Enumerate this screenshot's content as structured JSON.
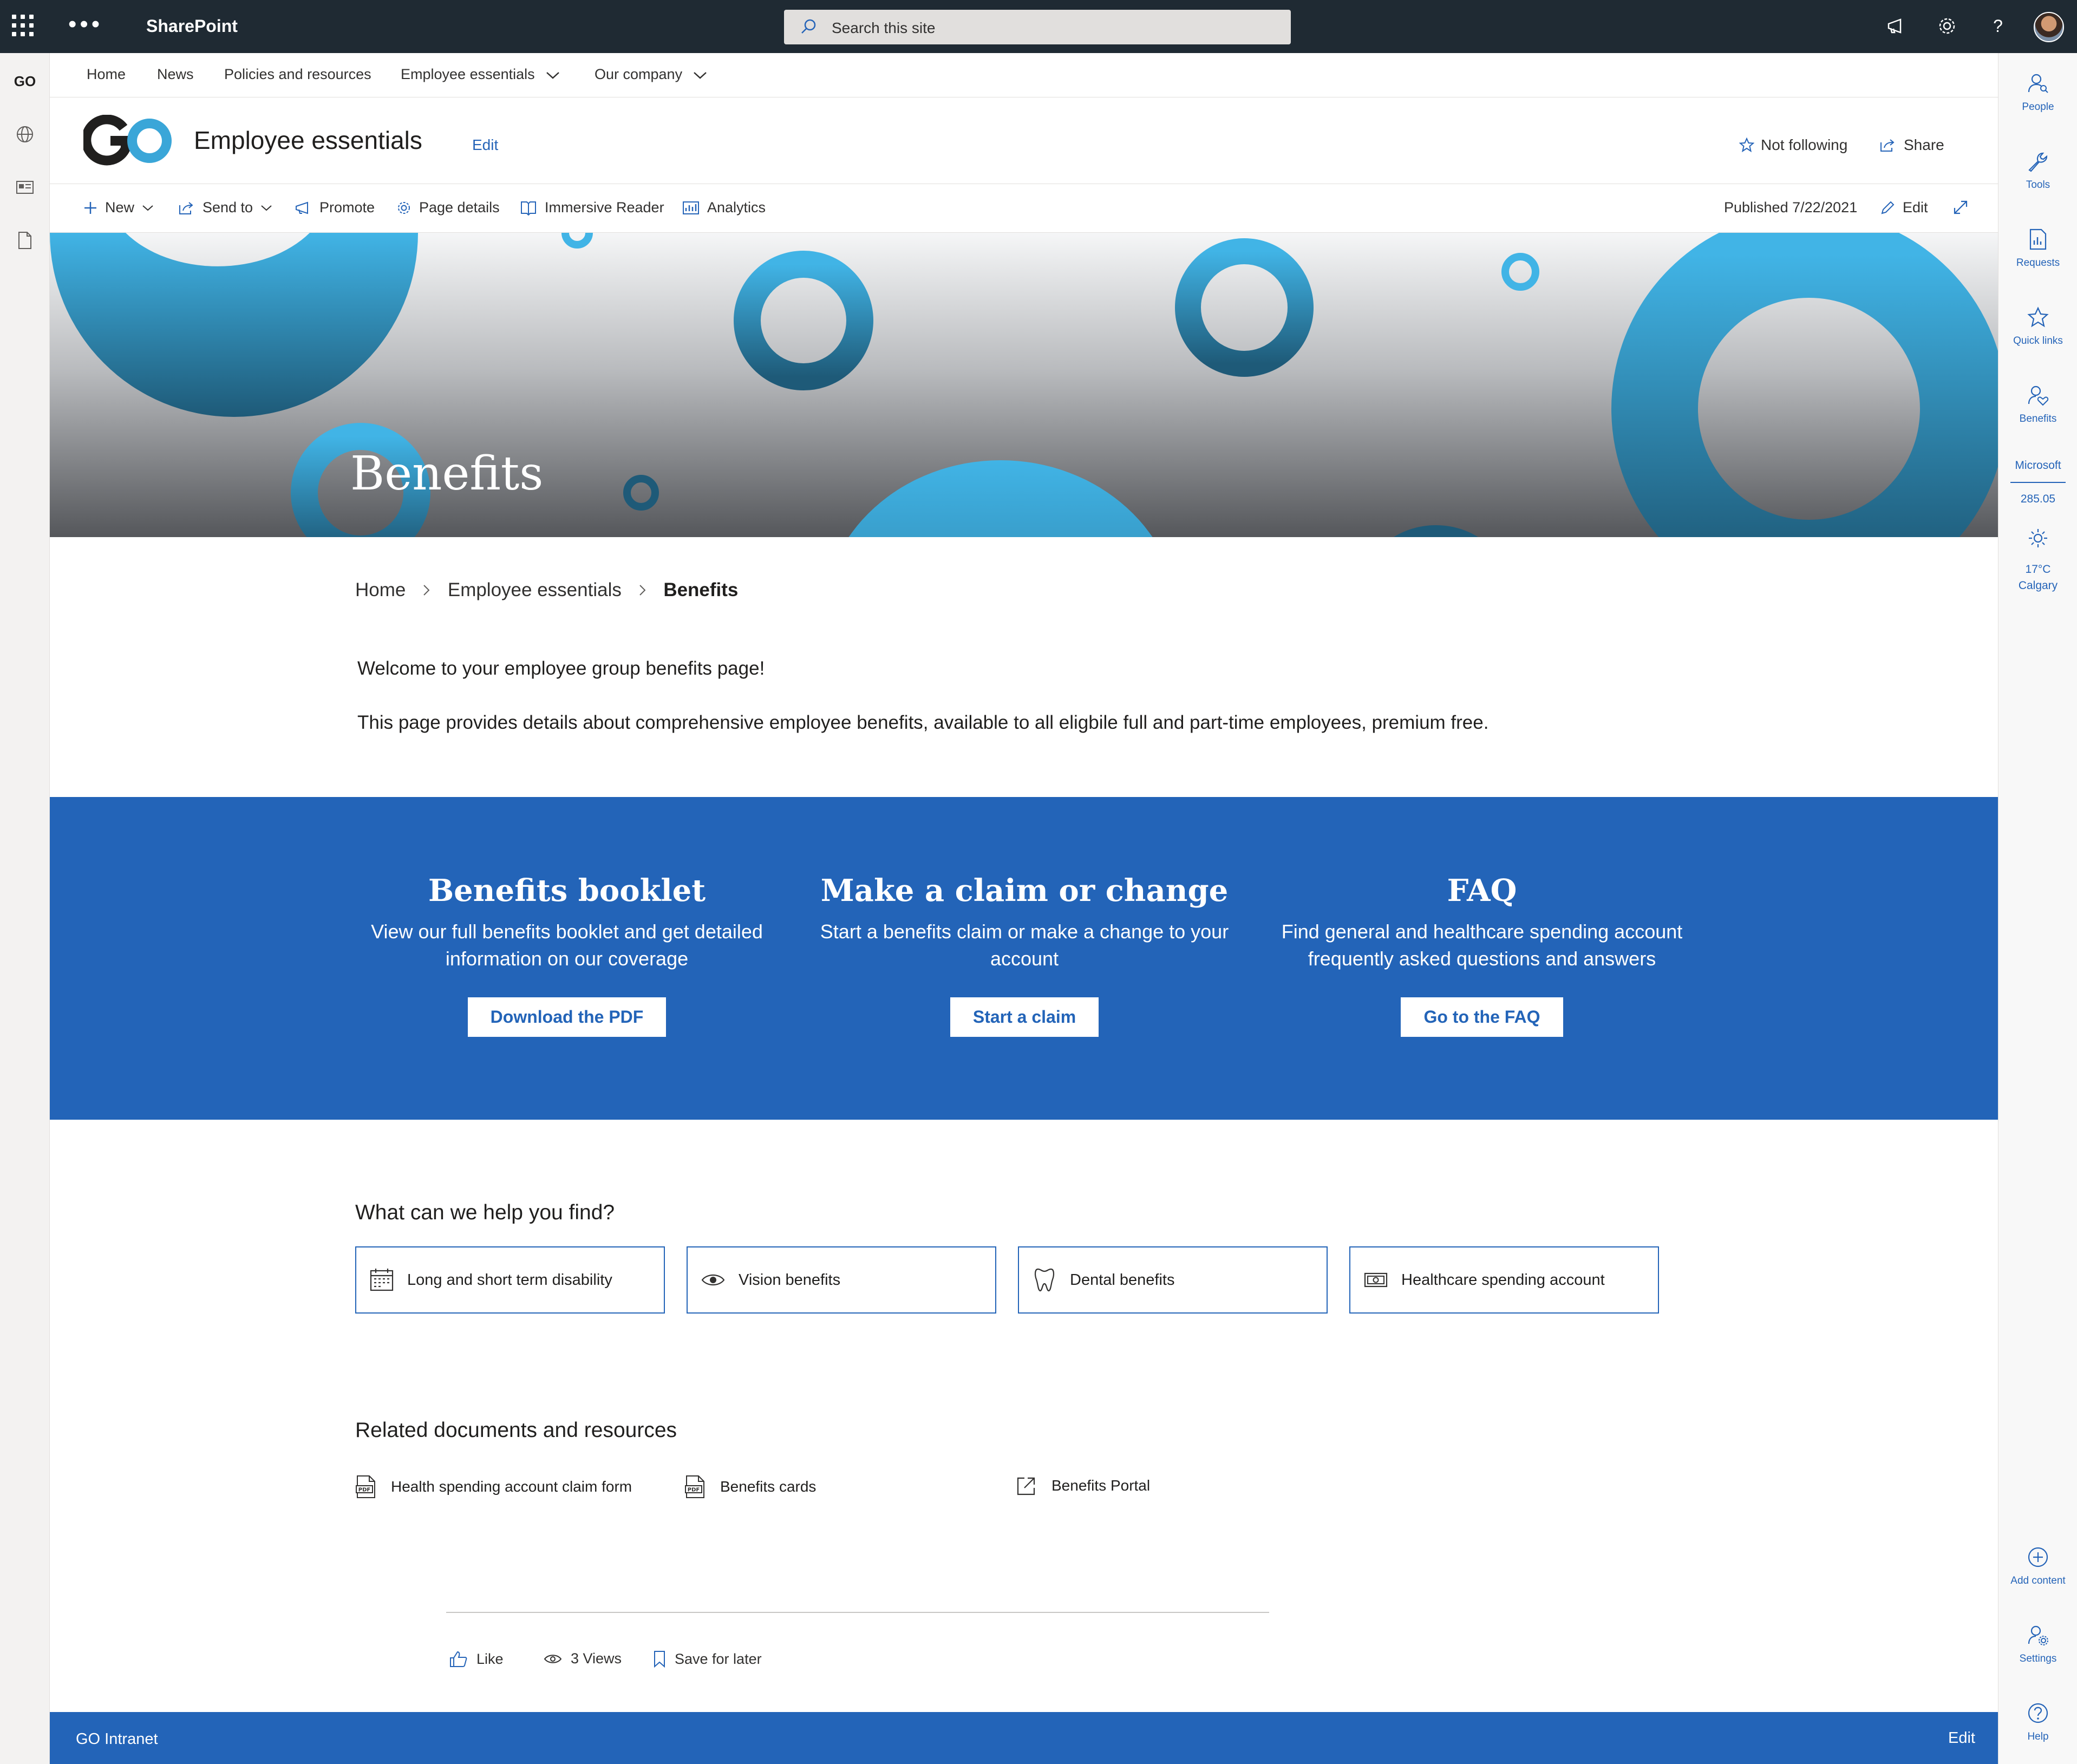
{
  "suite": {
    "brand": "SharePoint",
    "search_placeholder": "Search this site",
    "dots": "•••"
  },
  "leftrail": {
    "go_logo": "GO"
  },
  "nav": {
    "items": [
      "Home",
      "News",
      "Policies and resources",
      "Employee essentials",
      "Our company"
    ]
  },
  "header": {
    "title": "Employee essentials",
    "edit": "Edit",
    "follow": "Not following",
    "share": "Share"
  },
  "commands": {
    "new": "New",
    "send_to": "Send to",
    "promote": "Promote",
    "page_details": "Page details",
    "immersive_reader": "Immersive Reader",
    "analytics": "Analytics",
    "published": "Published 7/22/2021",
    "edit": "Edit"
  },
  "hero": {
    "title": "Benefits"
  },
  "breadcrumb": {
    "home": "Home",
    "section": "Employee essentials",
    "current": "Benefits"
  },
  "intro": {
    "line1": "Welcome to your employee group benefits page!",
    "line2": "This page provides details about comprehensive employee benefits, available to all eligbile full and part-time employees, premium free."
  },
  "band": {
    "columns": [
      {
        "title": "Benefits booklet",
        "line1": "View our full benefits booklet and get detailed",
        "line2": "information on our coverage",
        "button": "Download the PDF"
      },
      {
        "title": "Make a claim or change",
        "line1": "Start a benefits claim or make a change to your",
        "line2": "account",
        "button": "Start a claim"
      },
      {
        "title": "FAQ",
        "line1": "Find general and healthcare spending account",
        "line2": "frequently asked questions and answers",
        "button": "Go to the FAQ"
      }
    ]
  },
  "help": {
    "title": "What can we help you find?",
    "tiles": [
      {
        "label": "Long and short term disability",
        "icon": "calendar-icon"
      },
      {
        "label": "Vision benefits",
        "icon": "eye-icon"
      },
      {
        "label": "Dental benefits",
        "icon": "tooth-icon"
      },
      {
        "label": "Healthcare spending account",
        "icon": "money-icon"
      }
    ]
  },
  "related": {
    "title": "Related documents and resources",
    "items": [
      {
        "label": "Health spending account claim form",
        "icon": "pdf-icon"
      },
      {
        "label": "Benefits cards",
        "icon": "pdf-icon"
      },
      {
        "label": "Benefits Portal",
        "icon": "external-link-icon"
      }
    ]
  },
  "social": {
    "like": "Like",
    "views": "3 Views",
    "save": "Save for later"
  },
  "rightrail": {
    "items": [
      "People",
      "Tools",
      "Requests",
      "Quick links",
      "Benefits"
    ],
    "stock_name": "Microsoft",
    "stock_value": "285.05",
    "weather_temp": "17°C",
    "weather_city": "Calgary",
    "bottom_items": [
      "Add content",
      "Settings",
      "Help"
    ]
  },
  "footer": {
    "name": "GO Intranet",
    "edit": "Edit"
  },
  "colors": {
    "accent": "#2364b8",
    "suitebar": "#1f2a33",
    "hero_circle": "#3aa6d8"
  }
}
